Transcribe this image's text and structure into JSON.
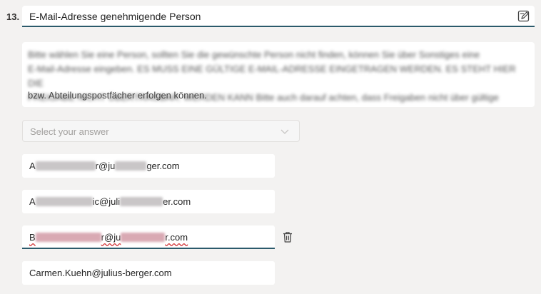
{
  "question": {
    "number": "13.",
    "title": "E-Mail-Adresse genehmigende Person",
    "description_visible": "bzw. Abteilungspostfächer erfolgen können.",
    "description_redacted_lines": [
      "Bitte wählen Sie eine Person, sollten Sie die gewünschte Person nicht finden, können Sie über Sonstiges eine",
      "E-Mail-Adresse eingeben. ES MUSS EINE GÜLTIGE E-MAIL-ADRESSE EINGETRAGEN WERDEN. ES STEHT HIER DIE",
      "FREIGABE NICHT ÜBERTRAGBAR. WERDEN KANN Bitte auch darauf achten, dass Freigaben nicht über gültige"
    ]
  },
  "select": {
    "placeholder": "Select your answer"
  },
  "options": [
    {
      "visible_parts": [
        "A",
        "r@ju",
        "ger.com"
      ]
    },
    {
      "visible_parts": [
        "A",
        "ic@juli",
        "er.com"
      ]
    },
    {
      "visible_parts": [
        "B",
        "r@ju",
        "r.com"
      ]
    },
    {
      "text": "Carmen.Kuehn@julius-berger.com"
    }
  ],
  "icons": {
    "edit": "edit-note-icon",
    "chevron": "chevron-down-icon",
    "delete": "trash-icon"
  },
  "colors": {
    "accent": "#2b5a6b",
    "background": "#f3f2f1",
    "placeholder": "#a19f9d"
  }
}
